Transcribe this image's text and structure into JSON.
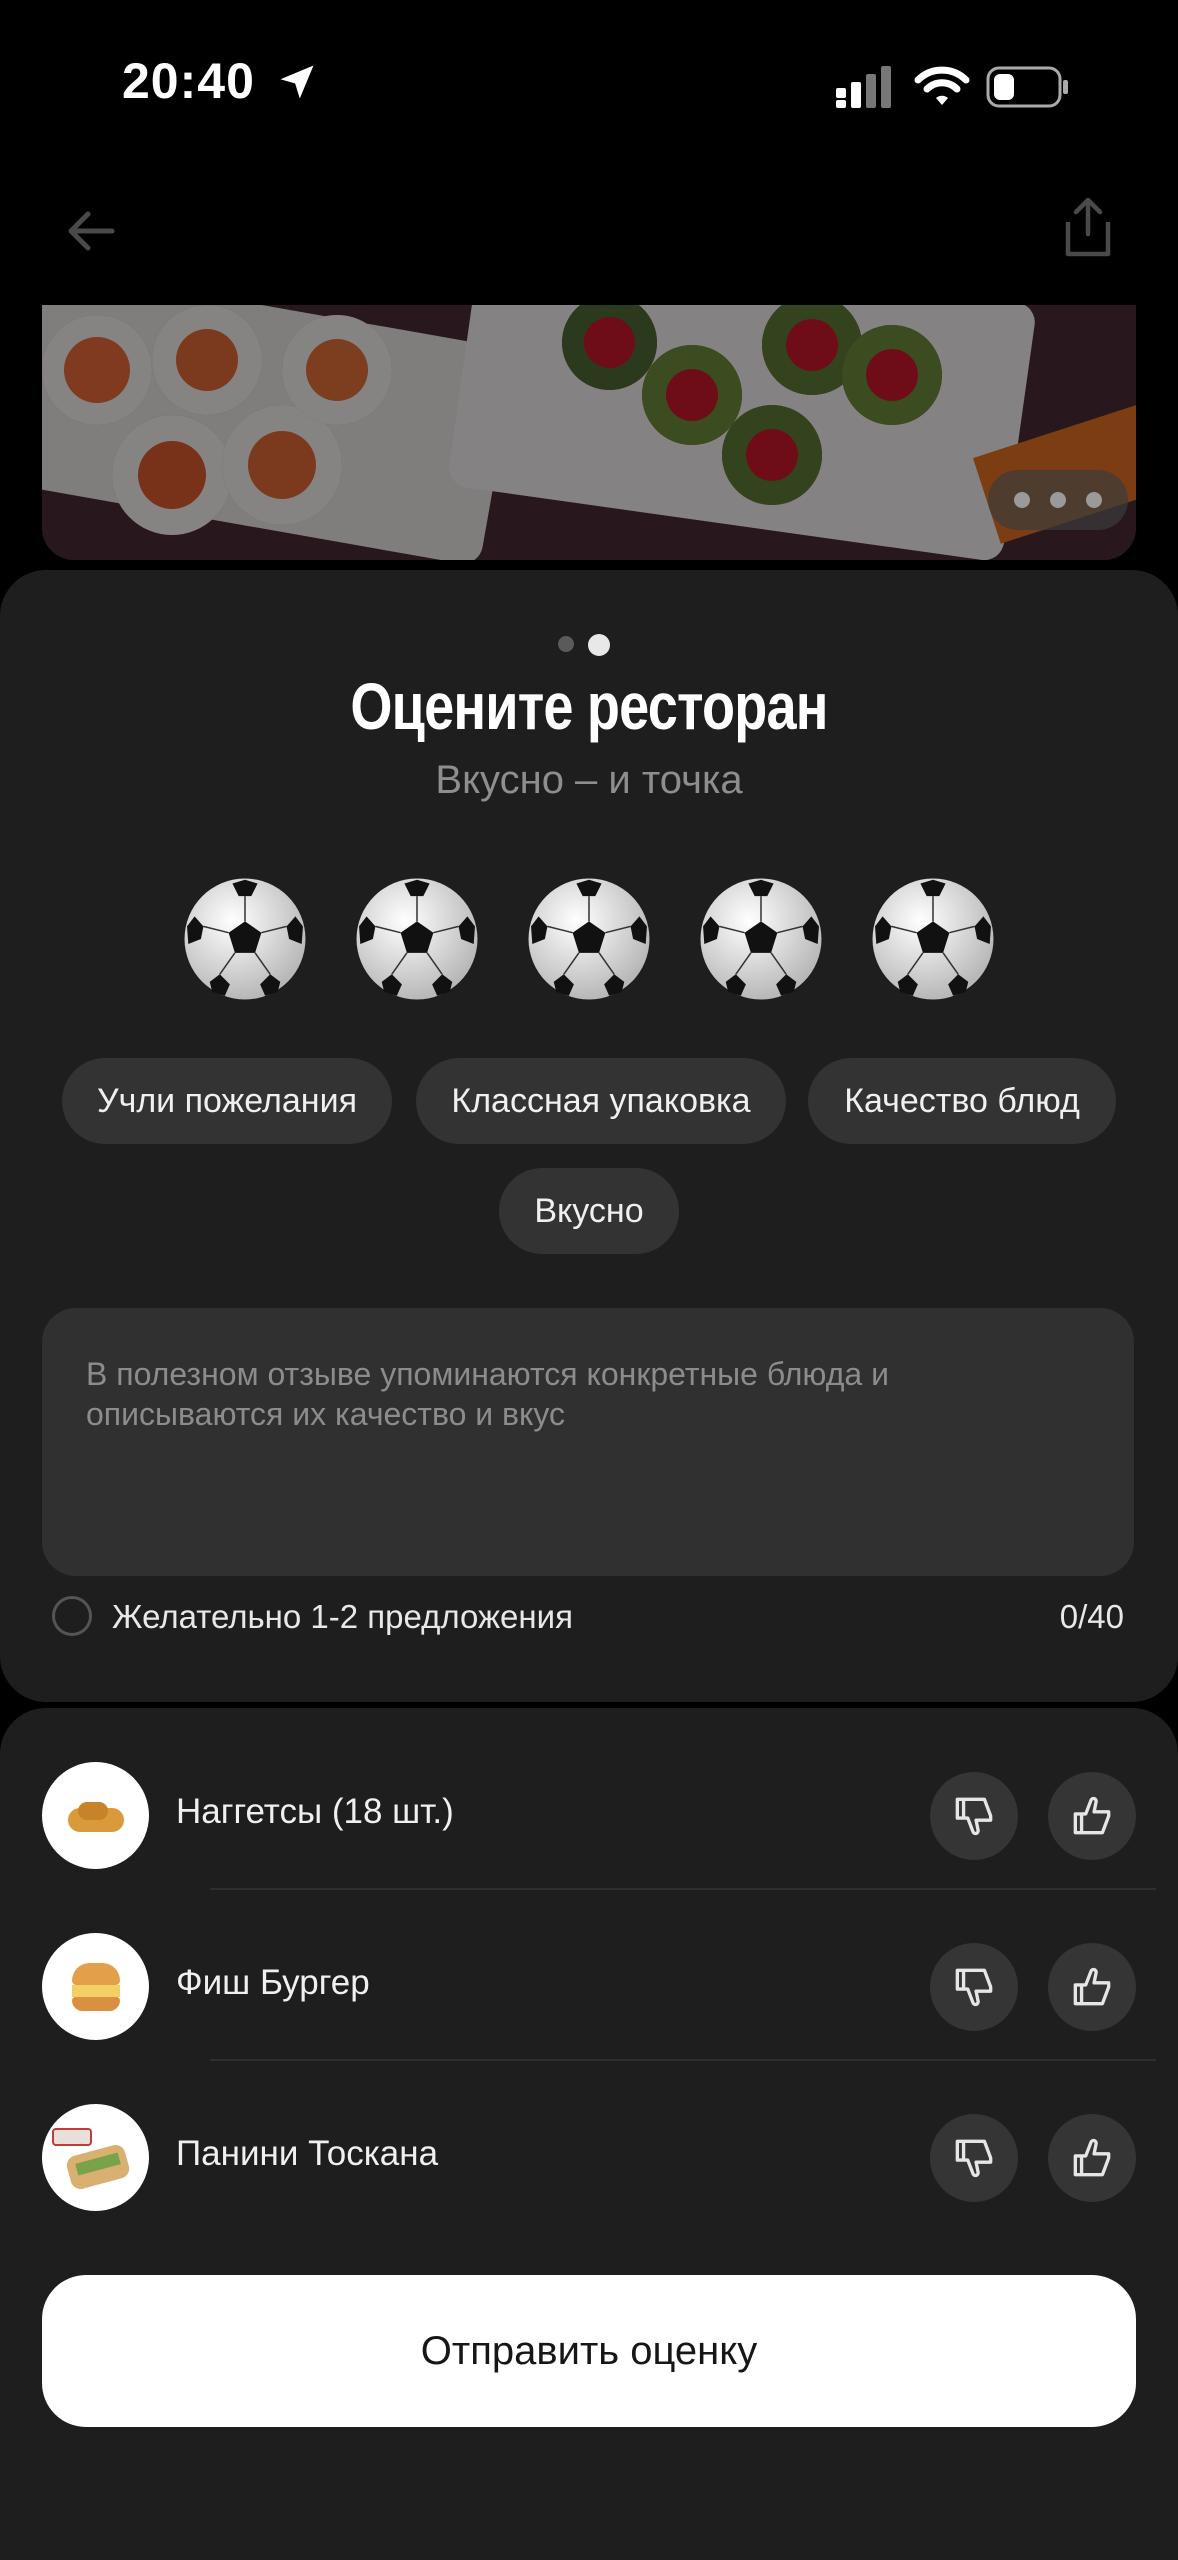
{
  "status_bar": {
    "time": "20:40",
    "icons": [
      "location-arrow-icon",
      "cellular-signal-icon",
      "wifi-icon",
      "battery-icon"
    ]
  },
  "top_bar": {
    "icons": [
      "back-arrow-icon",
      "share-icon"
    ]
  },
  "banner": {
    "image": "sushi-rolls-photo",
    "pager": "more-dots-icon"
  },
  "rating": {
    "title": "Оцените ресторан",
    "subtitle": "Вкусно – и точка",
    "rating_icon": "soccer-ball-icon",
    "max_rating": 5,
    "chips": [
      "Учли пожелания",
      "Классная упаковка",
      "Качество блюд",
      "Вкусно"
    ],
    "comment": {
      "placeholder": "В полезном отзыве упоминаются конкретные блюда и описываются их качество и вкус",
      "hint": "Желательно 1-2 предложения",
      "counter": "0/40"
    }
  },
  "items": [
    {
      "name": "Наггетсы (18 шт.)",
      "image": "nuggets-photo"
    },
    {
      "name": "Фиш Бургер",
      "image": "fish-burger-photo"
    },
    {
      "name": "Панини Тоскана",
      "image": "panini-photo"
    }
  ],
  "submit_label": "Отправить оценку",
  "colors": {
    "background": "#000000",
    "sheet": "#1e1e1e",
    "chip": "#333333",
    "button": "#ffffff"
  }
}
